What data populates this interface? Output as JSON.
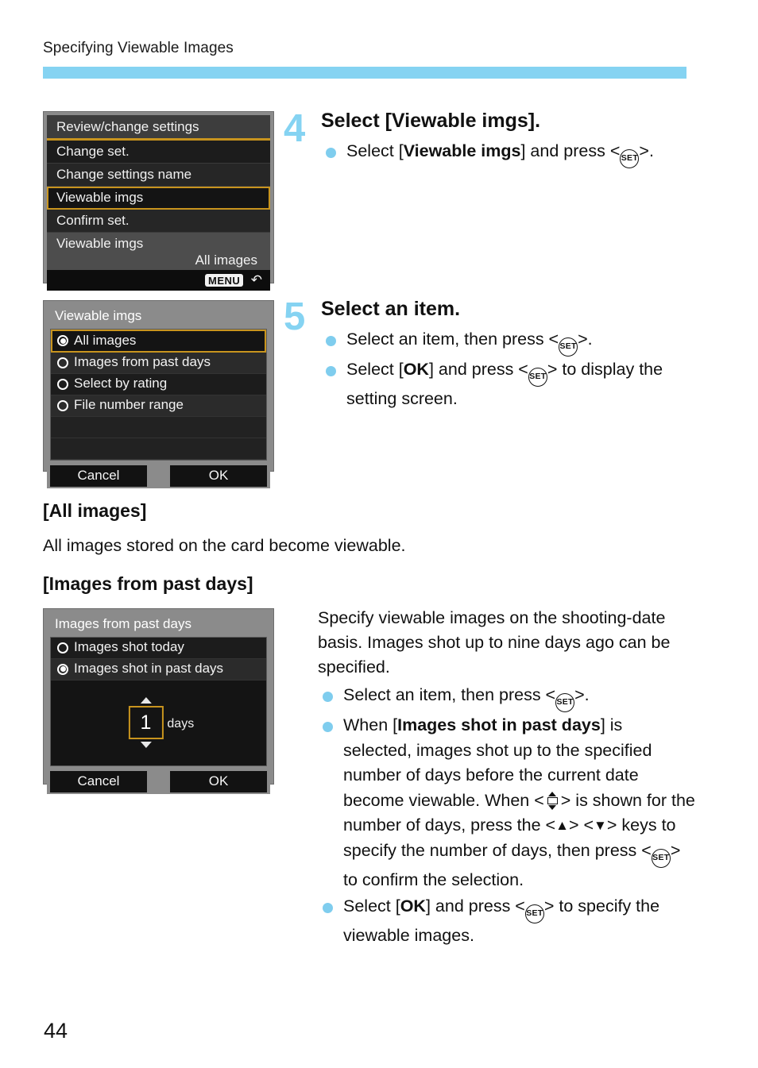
{
  "page": {
    "running_head": "Specifying Viewable Images",
    "page_number": "44",
    "accent_color": "#85d3f2",
    "highlight_color": "#c8941e"
  },
  "screens": {
    "review_change_settings": {
      "title": "Review/change settings",
      "items": [
        {
          "label": "Change set.",
          "selected": false
        },
        {
          "label": "Change settings name",
          "selected": false
        },
        {
          "label": "Viewable imgs",
          "selected": true
        },
        {
          "label": "Confirm set.",
          "selected": false
        }
      ],
      "info_label": "Viewable imgs",
      "info_value": "All images",
      "footer_badge": "MENU",
      "footer_arrow": "↶"
    },
    "viewable_imgs": {
      "title": "Viewable imgs",
      "options": [
        {
          "label": "All images",
          "checked": true,
          "selected": true
        },
        {
          "label": "Images from past days",
          "checked": false,
          "selected": false
        },
        {
          "label": "Select by rating",
          "checked": false,
          "selected": false
        },
        {
          "label": "File number range",
          "checked": false,
          "selected": false
        }
      ],
      "cancel_label": "Cancel",
      "ok_label": "OK"
    },
    "images_from_past_days": {
      "title": "Images from past days",
      "options": [
        {
          "label": "Images shot today",
          "checked": false
        },
        {
          "label": "Images shot in past days",
          "checked": true
        }
      ],
      "days_value": "1",
      "days_unit": "days",
      "cancel_label": "Cancel",
      "ok_label": "OK"
    }
  },
  "steps": {
    "step4": {
      "number": "4",
      "title": "Select [Viewable imgs].",
      "bullets": [
        {
          "pre": "Select [",
          "bold": "Viewable imgs",
          "mid": "] and press <",
          "icon": "set-key-icon",
          "post": ">."
        }
      ]
    },
    "step5": {
      "number": "5",
      "title": "Select an item.",
      "bullets": [
        {
          "pre": "Select an item, then press <",
          "icon": "set-key-icon",
          "post": ">."
        },
        {
          "pre": "Select [",
          "bold": "OK",
          "mid": "] and press <",
          "icon": "set-key-icon",
          "post": "> to display the setting screen."
        }
      ]
    }
  },
  "sections": {
    "all_images": {
      "heading": "[All images]",
      "body": "All images stored on the card become viewable."
    },
    "past_days": {
      "heading": "[Images from past days]",
      "intro": "Specify viewable images on the shooting-date basis. Images shot up to nine days ago can be specified.",
      "bullets": [
        {
          "pre": "Select an item, then press <",
          "icon": "set-key-icon",
          "post": ">."
        },
        {
          "pre": "When [",
          "bold": "Images shot in past days",
          "mid": "] is selected, images shot up to the specified number of days before the current date become viewable. When <",
          "icon": "up-down-key-icon",
          "mid2": "> is shown for the number of days, press the <",
          "icon2": "up-arrow-icon",
          "mid3": "> <",
          "icon3": "down-arrow-icon",
          "mid4": "> keys to specify the number of days, then press <",
          "icon4": "set-key-icon",
          "post": "> to confirm the selection."
        },
        {
          "pre": "Select [",
          "bold": "OK",
          "mid": "] and press <",
          "icon": "set-key-icon",
          "post": "> to specify the viewable images."
        }
      ]
    }
  },
  "icons": {
    "set_key_label": "SET",
    "up_triangle": "▲",
    "down_triangle": "▼"
  }
}
